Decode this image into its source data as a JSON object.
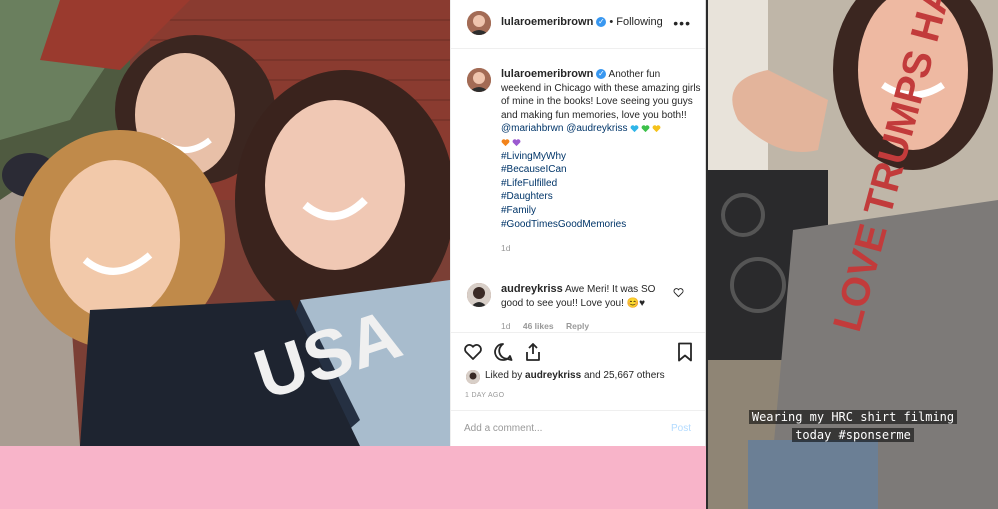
{
  "post": {
    "username": "lularoemeribrown",
    "follow_label": "• Following",
    "caption_text": "Another fun weekend in Chicago with these amazing girls of mine in the books! Love seeing you guys and making fun memories, love you both!!",
    "mention_1": "@mariahbrwn",
    "mention_2": "@audreykriss",
    "hashtags": [
      "#LivingMyWhy",
      "#BecauseICan",
      "#LifeFulfilled",
      "#Daughters",
      "#Family",
      "#GoodTimesGoodMemories"
    ],
    "caption_time": "1d",
    "comment": {
      "username": "audreykriss",
      "text": "Awe Meri! It was SO good to see you!! Love you! 😊♥",
      "time": "1d",
      "likes": "46 likes",
      "reply": "Reply"
    },
    "liked_prefix": "Liked by ",
    "liked_user": "audreykriss",
    "liked_suffix": " and 25,667 others",
    "date": "1 DAY AGO",
    "add_comment_placeholder": "Add a comment...",
    "post_label": "Post"
  },
  "story": {
    "line1": "Wearing my HRC shirt filming",
    "line2": "today #sponserme"
  },
  "shirt_left_text": "USA",
  "shirt_right_text": "LOVE TRUMPS HATE",
  "colors": {
    "pink_band": "#f8b4c9",
    "link": "#003569",
    "verified": "#3897f0"
  }
}
